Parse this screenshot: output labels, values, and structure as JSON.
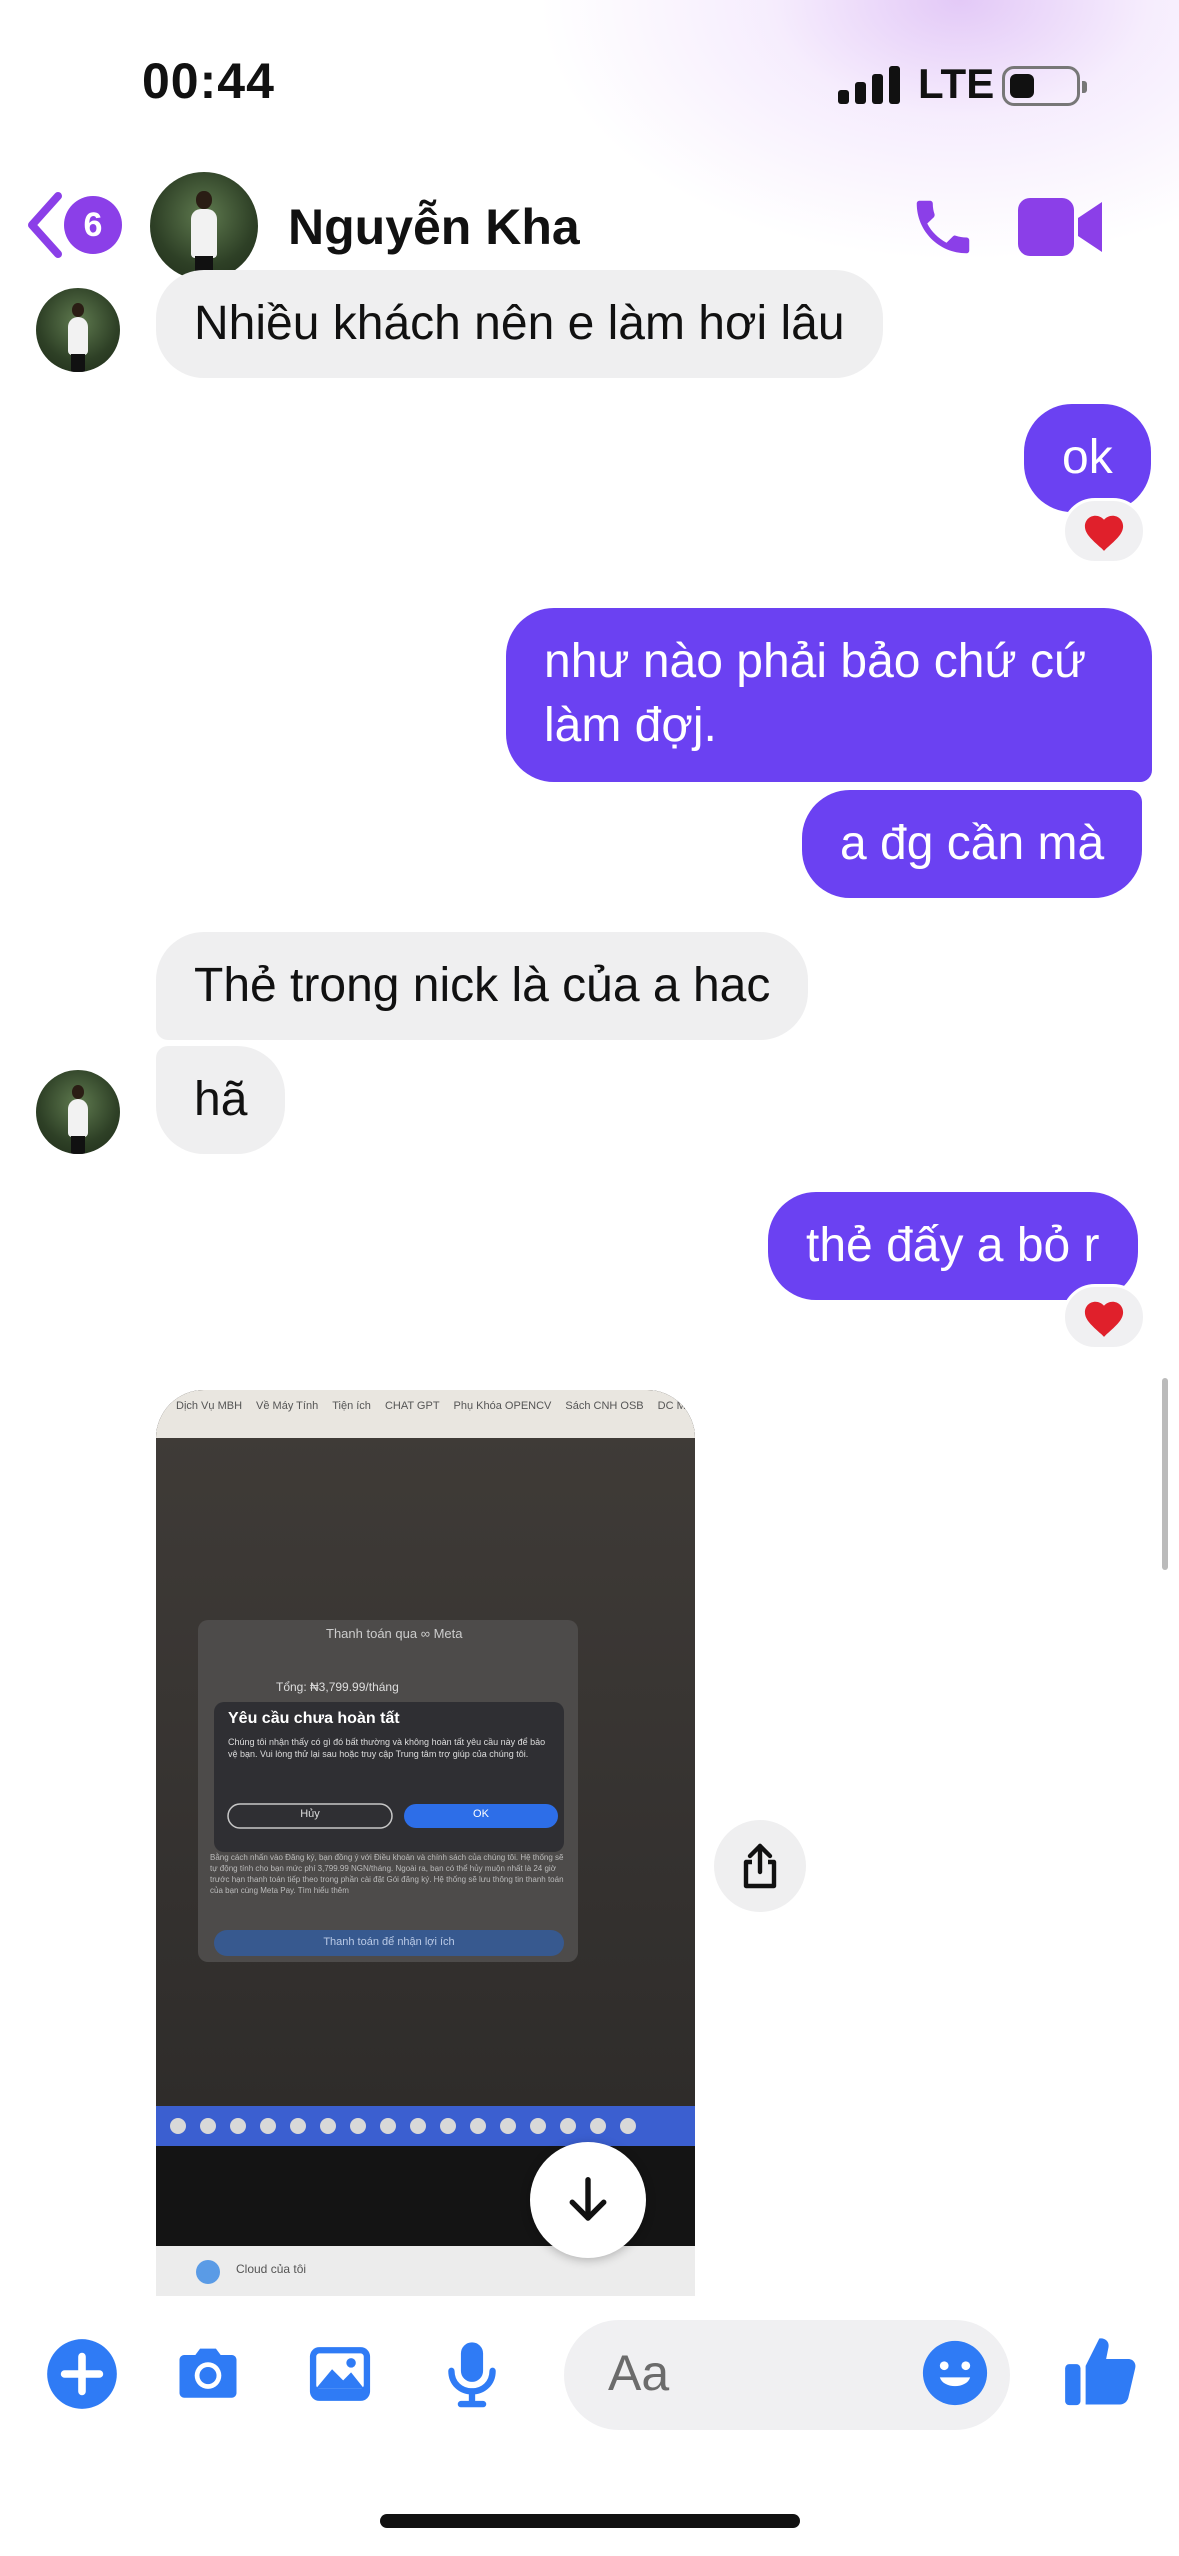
{
  "status_bar": {
    "time": "00:44",
    "network": "LTE"
  },
  "header": {
    "unread_count": "6",
    "contact_name": "Nguyễn Kha"
  },
  "messages": [
    {
      "side": "in",
      "text": "Nhiều khách nên e làm hơi lâu"
    },
    {
      "side": "out",
      "text": "ok",
      "reaction": "❤️"
    },
    {
      "side": "out",
      "lines": [
        "như nào phải bảo chứ cứ",
        "làm đợj."
      ]
    },
    {
      "side": "out",
      "text": "a đg cần mà"
    },
    {
      "side": "in",
      "text": "Thẻ trong nick là của a hac"
    },
    {
      "side": "in",
      "text": "hã"
    },
    {
      "side": "out",
      "text": "thẻ đấy a bỏ r",
      "reaction": "❤️"
    }
  ],
  "photo": {
    "bookmarks": [
      "Dịch Vụ MBH",
      "Về Máy Tính",
      "Tiện ích",
      "CHAT GPT",
      "Phụ Khóa OPENCV",
      "Sách CNH OSB",
      "DC Meta"
    ],
    "dialog_title": "Thanh toán qua ∞ Meta",
    "total": "Tổng: ₦3,799.99/tháng",
    "alert_title": "Yêu cầu chưa hoàn tất",
    "alert_body": "Chúng tôi nhận thấy có gì đó bất thường và không hoàn tất yêu cầu này để bảo vệ bạn. Vui lòng thử lại sau hoặc truy cập Trung tâm trợ giúp của chúng tôi.",
    "cancel_label": "Hủy",
    "ok_label": "OK",
    "terms_text": "Bằng cách nhấn vào Đăng ký, bạn đồng ý với Điều khoản và chính sách của chúng tôi. Hệ thống sẽ tự động tính cho bạn mức phí 3,799.99 NGN/tháng. Ngoài ra, bạn có thể hủy muộn nhất là 24 giờ trước hạn thanh toán tiếp theo trong phần cài đặt Gói đăng ký. Hệ thống sẽ lưu thông tin thanh toán của bạn cùng Meta Pay. Tìm hiểu thêm",
    "pay_button": "Thanh toán để nhận lợi ích",
    "cloud_label": "Cloud của tôi"
  },
  "composer": {
    "placeholder": "Aa"
  },
  "colors": {
    "accent": "#8b3fe8",
    "outgoing_bubble": "#6b41f2",
    "composer_icons": "#2f7bf5"
  }
}
